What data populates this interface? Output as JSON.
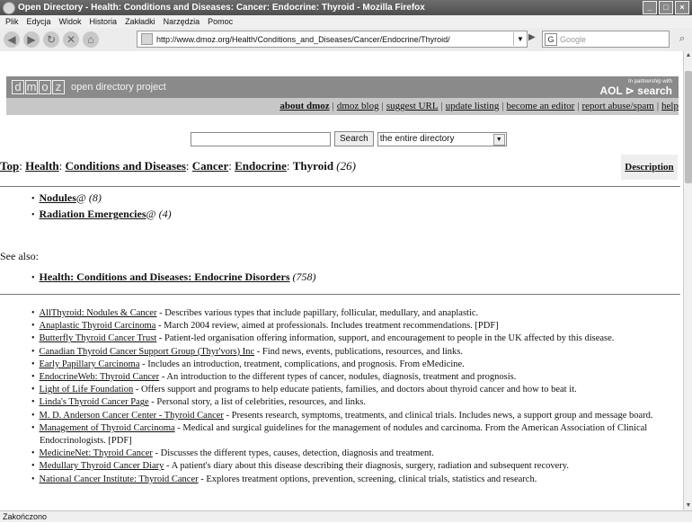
{
  "window": {
    "title": "Open Directory - Health: Conditions and Diseases: Cancer: Endocrine: Thyroid - Mozilla Firefox"
  },
  "menu": [
    "Plik",
    "Edycja",
    "Widok",
    "Historia",
    "Zakładki",
    "Narzędzia",
    "Pomoc"
  ],
  "nav": {
    "url": "http://www.dmoz.org/Health/Conditions_and_Diseases/Cancer/Endocrine/Thyroid/",
    "search_placeholder": "Google",
    "search_engine": "G"
  },
  "header": {
    "logo_letters": [
      "d",
      "m",
      "o",
      "z"
    ],
    "logo_text": "open directory project",
    "partner_line": "In partnership with",
    "partner_brand": "AOL ⊳ search",
    "links": [
      "about dmoz",
      "dmoz blog",
      "suggest URL",
      "update listing",
      "become an editor",
      "report abuse/spam",
      "help"
    ]
  },
  "search": {
    "button": "Search",
    "scope": "the entire directory"
  },
  "breadcrumb": {
    "items": [
      "Top",
      "Health",
      "Conditions and Diseases",
      "Cancer",
      "Endocrine"
    ],
    "current": "Thyroid",
    "count": "(26)",
    "description_link": "Description"
  },
  "subcategories": [
    {
      "name": "Nodules",
      "suffix": "@",
      "count": "(8)"
    },
    {
      "name": "Radiation Emergencies",
      "suffix": "@",
      "count": "(4)"
    }
  ],
  "see_also": {
    "label": "See also:",
    "items": [
      {
        "name": "Health: Conditions and Diseases: Endocrine Disorders",
        "count": "(758)"
      }
    ]
  },
  "sites": [
    {
      "title": "AllThyroid: Nodules & Cancer",
      "desc": " - Describes various types that include papillary, follicular, medullary, and anaplastic."
    },
    {
      "title": "Anaplastic Thyroid Carcinoma",
      "desc": " - March 2004 review, aimed at professionals. Includes treatment recommendations. [PDF]"
    },
    {
      "title": "Butterfly Thyroid Cancer Trust",
      "desc": " - Patient-led organisation offering information, support, and encouragement to people in the UK affected by this disease."
    },
    {
      "title": "Canadian Thyroid Cancer Support Group (Thyr'vors) Inc",
      "desc": " - Find news, events, publications, resources, and links."
    },
    {
      "title": "Early Papillary Carcinoma",
      "desc": " - Includes an introduction, treatment, complications, and prognosis. From eMedicine."
    },
    {
      "title": "EndocrineWeb: Thyroid Cancer",
      "desc": " - An introduction to the different types of cancer, nodules, diagnosis, treatment and prognosis."
    },
    {
      "title": "Light of Life Foundation",
      "desc": " - Offers support and programs to help educate patients, families, and doctors about thyroid cancer and how to beat it."
    },
    {
      "title": "Linda's Thyroid Cancer Page",
      "desc": " - Personal story, a list of celebrities, resources, and links."
    },
    {
      "title": "M. D. Anderson Cancer Center - Thyroid Cancer",
      "desc": " - Presents research, symptoms, treatments, and clinical trials. Includes news, a support group and message board."
    },
    {
      "title": "Management of Thyroid Carcinoma",
      "desc": " - Medical and surgical guidelines for the management of nodules and carcinoma. From the American Association of Clinical Endocrinologists. [PDF]"
    },
    {
      "title": "MedicineNet: Thyroid Cancer",
      "desc": " - Discusses the different types, causes, detection, diagnosis and treatment."
    },
    {
      "title": "Medullary Thyroid Cancer Diary",
      "desc": " - A patient's diary about this disease describing their diagnosis, surgery, radiation and subsequent recovery."
    },
    {
      "title": "National Cancer Institute: Thyroid Cancer",
      "desc": " - Explores treatment options, prevention, screening, clinical trials, statistics and research."
    }
  ],
  "status": "Zakończono"
}
